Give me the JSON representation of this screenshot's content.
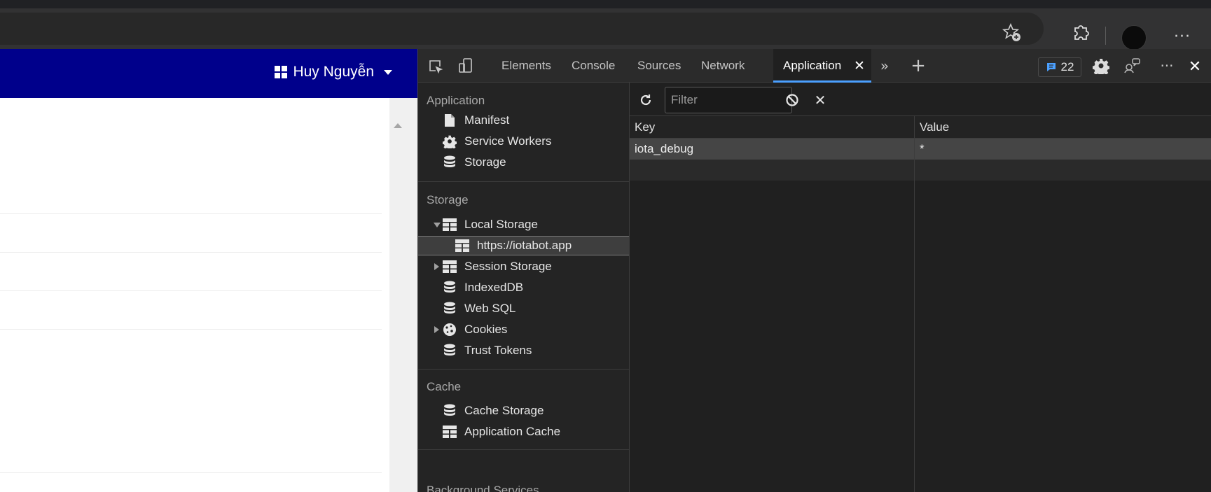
{
  "page": {
    "user_name": "Huy Nguyễn"
  },
  "devtools": {
    "tabs": [
      "Elements",
      "Console",
      "Sources",
      "Network",
      "Application"
    ],
    "active_tab": "Application",
    "issues_count": "22",
    "sidebar": {
      "sections": {
        "application": "Application",
        "storage": "Storage",
        "cache": "Cache",
        "background": "Background Services"
      },
      "application_items": [
        "Manifest",
        "Service Workers",
        "Storage"
      ],
      "storage_items": [
        "Local Storage",
        "https://iotabot.app",
        "Session Storage",
        "IndexedDB",
        "Web SQL",
        "Cookies",
        "Trust Tokens"
      ],
      "cache_items": [
        "Cache Storage",
        "Application Cache"
      ]
    },
    "filter_placeholder": "Filter",
    "table": {
      "key_header": "Key",
      "value_header": "Value",
      "rows": [
        {
          "key": "iota_debug",
          "value": "*"
        }
      ]
    }
  },
  "colors": {
    "page_header": "#00008b",
    "accent": "#4ba0ff",
    "issues_badge": "#4ba0ff"
  }
}
